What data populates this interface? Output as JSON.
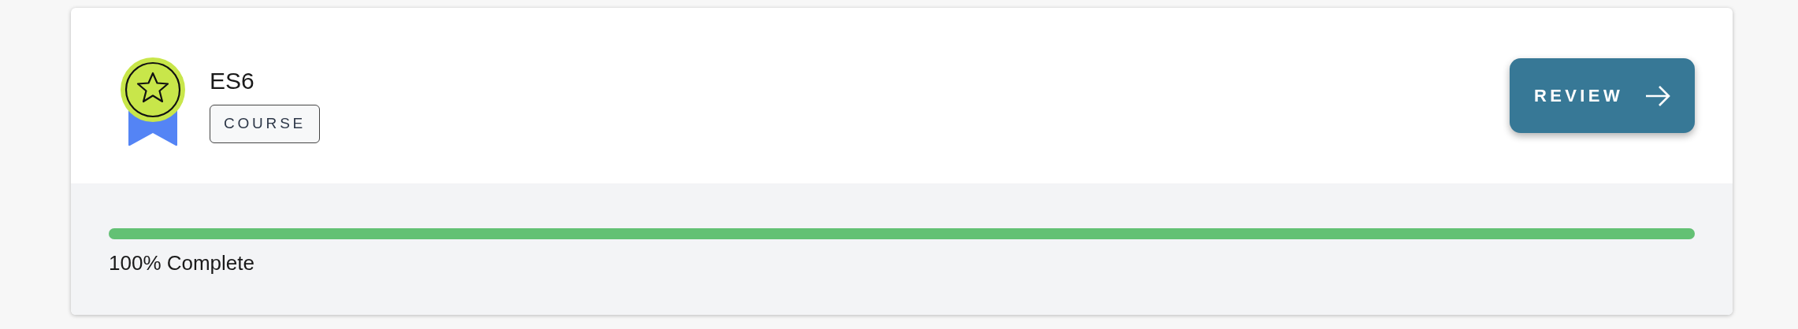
{
  "course": {
    "title": "ES6",
    "tag": "COURSE",
    "button": "REVIEW"
  },
  "progress": {
    "level": 1.0,
    "label": "100% Complete"
  }
}
